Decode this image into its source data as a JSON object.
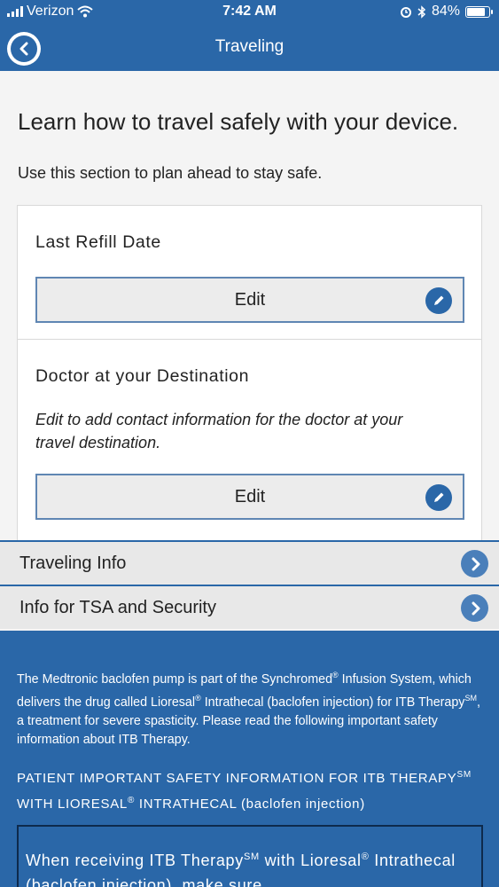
{
  "status_bar": {
    "carrier": "Verizon",
    "time": "7:42 AM",
    "battery": "84%",
    "battery_level": 0.84
  },
  "nav": {
    "title": "Traveling",
    "back_icon": "chevron-left-icon"
  },
  "main": {
    "heading": "Learn how to travel safely with your device.",
    "subheading": "Use this section to plan ahead to stay safe."
  },
  "cards": {
    "refill": {
      "title": "Last Refill Date",
      "button_label": "Edit"
    },
    "doctor": {
      "title": "Doctor at your Destination",
      "description": "Edit to add contact information for the doctor at your travel destination.",
      "button_label": "Edit"
    }
  },
  "rows": {
    "traveling_info": "Traveling Info",
    "tsa_security": "Info for TSA and Security"
  },
  "info": {
    "p_part1": "The Medtronic baclofen pump is part of the Synchromed",
    "p_sup1": "®",
    "p_part2": " Infusion System, which delivers the drug called Lioresal",
    "p_sup2": "®",
    "p_part3": " Intrathecal (baclofen injection) for ITB Therapy",
    "p_sup3": "SM",
    "p_part4": ", a treatment for severe spasticity. Please read the following important safety information about ITB Therapy.",
    "safety_part1": "PATIENT IMPORTANT SAFETY INFORMATION FOR ITB THERAPY",
    "safety_sup1": "SM",
    "safety_part2": " WITH LIORESAL",
    "safety_sup2": "®",
    "safety_part3": " INTRATHECAL (baclofen injection)",
    "box_part1": "When receiving ITB Therapy",
    "box_sup1": "SM",
    "box_part2": " with Lioresal",
    "box_sup2": "®",
    "box_part3": " Intrathecal (baclofen injection), make sure"
  },
  "colors": {
    "primary": "#2a67a8",
    "row_bg": "#e8e8e8",
    "button_border": "#5f86b3"
  }
}
